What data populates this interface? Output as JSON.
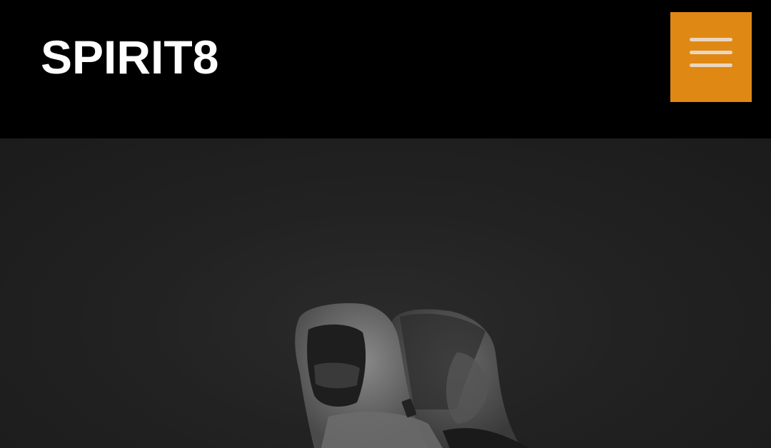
{
  "header": {
    "brand": "SPIRIT8",
    "menu_icon": "hamburger-menu-icon",
    "accent_color": "#e08814"
  },
  "hero": {
    "image_description_icon": "hooded-hikers-image"
  }
}
